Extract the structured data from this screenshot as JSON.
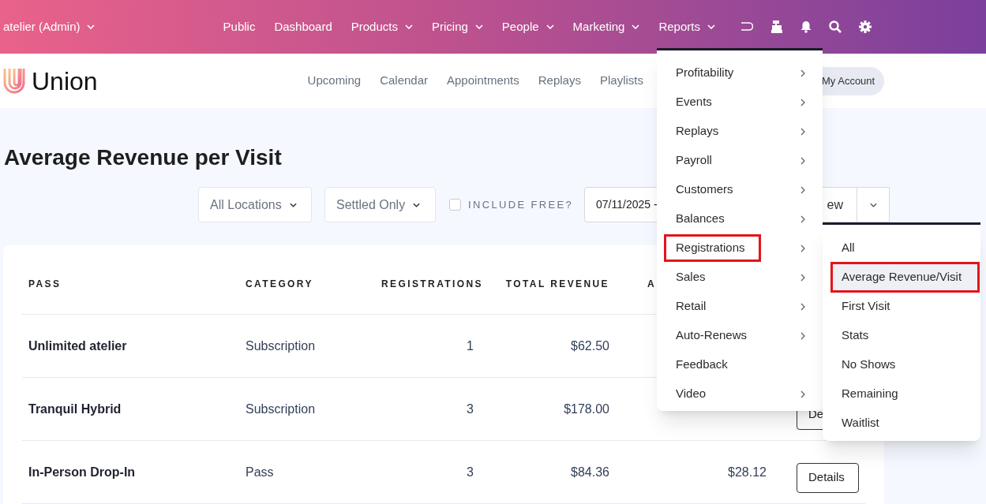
{
  "top_bar": {
    "studio": "atelier (Admin)",
    "nav": [
      {
        "label": "Public",
        "has_dropdown": false
      },
      {
        "label": "Dashboard",
        "has_dropdown": false
      },
      {
        "label": "Products",
        "has_dropdown": true
      },
      {
        "label": "Pricing",
        "has_dropdown": true
      },
      {
        "label": "People",
        "has_dropdown": true
      },
      {
        "label": "Marketing",
        "has_dropdown": true
      },
      {
        "label": "Reports",
        "has_dropdown": true
      }
    ]
  },
  "brand": {
    "name": "Union"
  },
  "sub_nav": [
    "Upcoming",
    "Calendar",
    "Appointments",
    "Replays",
    "Playlists"
  ],
  "account_button": "My Account",
  "page_title": "Average Revenue per Visit",
  "filters": {
    "location": "All Locations",
    "settlement": "Settled Only",
    "include_free": {
      "label": "INCLUDE FREE?",
      "checked": false
    },
    "date_range": "07/11/2025 -",
    "view_button": "ew"
  },
  "table": {
    "columns": [
      "PASS",
      "CATEGORY",
      "REGISTRATIONS",
      "TOTAL REVENUE",
      "A"
    ],
    "rows": [
      {
        "pass": "Unlimited atelier",
        "category": "Subscription",
        "registrations": "1",
        "total_revenue": "$62.50"
      },
      {
        "pass": "Tranquil Hybrid",
        "category": "Subscription",
        "registrations": "3",
        "total_revenue": "$178.00",
        "details": "De"
      },
      {
        "pass": "In-Person Drop-In",
        "category": "Pass",
        "registrations": "3",
        "total_revenue": "$84.36",
        "average": "$28.12",
        "details": "Details"
      }
    ]
  },
  "reports_menu": {
    "items": [
      {
        "label": "Profitability",
        "has_submenu": true,
        "highlighted": false
      },
      {
        "label": "Events",
        "has_submenu": true,
        "highlighted": false
      },
      {
        "label": "Replays",
        "has_submenu": true,
        "highlighted": false
      },
      {
        "label": "Payroll",
        "has_submenu": true,
        "highlighted": false
      },
      {
        "label": "Customers",
        "has_submenu": true,
        "highlighted": false
      },
      {
        "label": "Balances",
        "has_submenu": true,
        "highlighted": false
      },
      {
        "label": "Registrations",
        "has_submenu": true,
        "highlighted": true
      },
      {
        "label": "Sales",
        "has_submenu": true,
        "highlighted": false
      },
      {
        "label": "Retail",
        "has_submenu": true,
        "highlighted": false
      },
      {
        "label": "Auto-Renews",
        "has_submenu": true,
        "highlighted": false
      },
      {
        "label": "Feedback",
        "has_submenu": false,
        "highlighted": false
      },
      {
        "label": "Video",
        "has_submenu": true,
        "highlighted": false
      }
    ]
  },
  "registrations_submenu": {
    "items": [
      {
        "label": "All",
        "selected": false,
        "highlighted": false
      },
      {
        "label": "Average Revenue/Visit",
        "selected": true,
        "highlighted": true
      },
      {
        "label": "First Visit",
        "selected": false,
        "highlighted": false
      },
      {
        "label": "Stats",
        "selected": false,
        "highlighted": false
      },
      {
        "label": "No Shows",
        "selected": false,
        "highlighted": false
      },
      {
        "label": "Remaining",
        "selected": false,
        "highlighted": false
      },
      {
        "label": "Waitlist",
        "selected": false,
        "highlighted": false
      }
    ]
  }
}
